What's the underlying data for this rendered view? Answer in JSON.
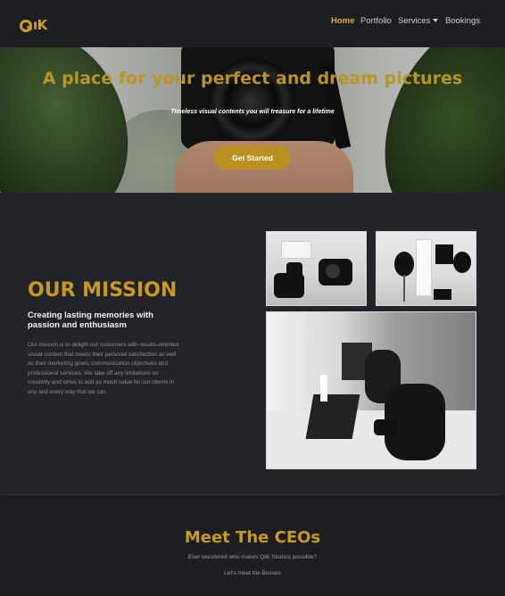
{
  "brand": {
    "logo_text": "ıK",
    "accent": "#c99a20"
  },
  "nav": {
    "home": "Home",
    "portfolio": "Portfolio",
    "services": "Services",
    "bookings": "Bookings"
  },
  "hero": {
    "title": "A place for your perfect and dream pictures",
    "subtitle": "Timeless visual contents you will treasure for a lifetime",
    "cta": "Get Started"
  },
  "mission": {
    "title": "OUR MISSION",
    "subtitle": "Creating lasting memories with passion and enthusiasm",
    "body": "Our mission is to delight our customers with results-oriented visual content that meets their personal satisfaction as well as their marketing goals, communication objectives and professional services. We take off any limitations on creativity and strive to add as much value for our clients in any and every way that we can"
  },
  "ceos": {
    "title": "Meet The CEOs",
    "question": "Ever wondered who makes Qiik Studios possible?",
    "link": "Let's meet the Bosses"
  }
}
